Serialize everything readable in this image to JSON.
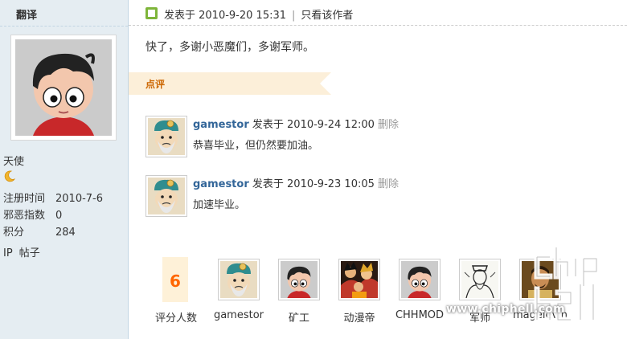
{
  "author": {
    "name": "翻译",
    "title": "天使",
    "stats": [
      {
        "label": "注册时间",
        "value": "2010-7-6"
      },
      {
        "label": "邪恶指数",
        "value": "0"
      },
      {
        "label": "积分",
        "value": "284"
      }
    ],
    "links": [
      "IP",
      "帖子"
    ]
  },
  "post": {
    "posted_label": "发表于 2010-9-20 15:31",
    "sep": "|",
    "only_author": "只看该作者",
    "body": "快了，多谢小恶魔们，多谢军师。"
  },
  "review": {
    "label": "点评",
    "comments": [
      {
        "user": "gamestor",
        "time": "发表于 2010-9-24 12:00",
        "delete": "删除",
        "text": "恭喜毕业，但仍然要加油。"
      },
      {
        "user": "gamestor",
        "time": "发表于 2010-9-23 10:05",
        "delete": "删除",
        "text": "加速毕业。"
      }
    ]
  },
  "rating": {
    "count": "6",
    "count_label": "评分人数",
    "raters": [
      {
        "name": "gamestor",
        "icon": "elder-avatar-icon"
      },
      {
        "name": "矿工",
        "icon": "cartoon-boy-avatar-icon"
      },
      {
        "name": "动漫帝",
        "icon": "anime-group-avatar-icon"
      },
      {
        "name": "CHHMOD",
        "icon": "cartoon-boy-avatar-icon"
      },
      {
        "name": "军师",
        "icon": "sketch-portrait-avatar-icon"
      },
      {
        "name": "magelevin",
        "icon": "photo-avatar-icon"
      }
    ]
  },
  "watermark": {
    "logo_text": "chip hell",
    "site": "www.chiphell.com"
  },
  "colors": {
    "sidebar_bg": "#e5edf2",
    "link_blue": "#369",
    "review_label": "#cc6600",
    "rating_orange": "#ff6600"
  }
}
